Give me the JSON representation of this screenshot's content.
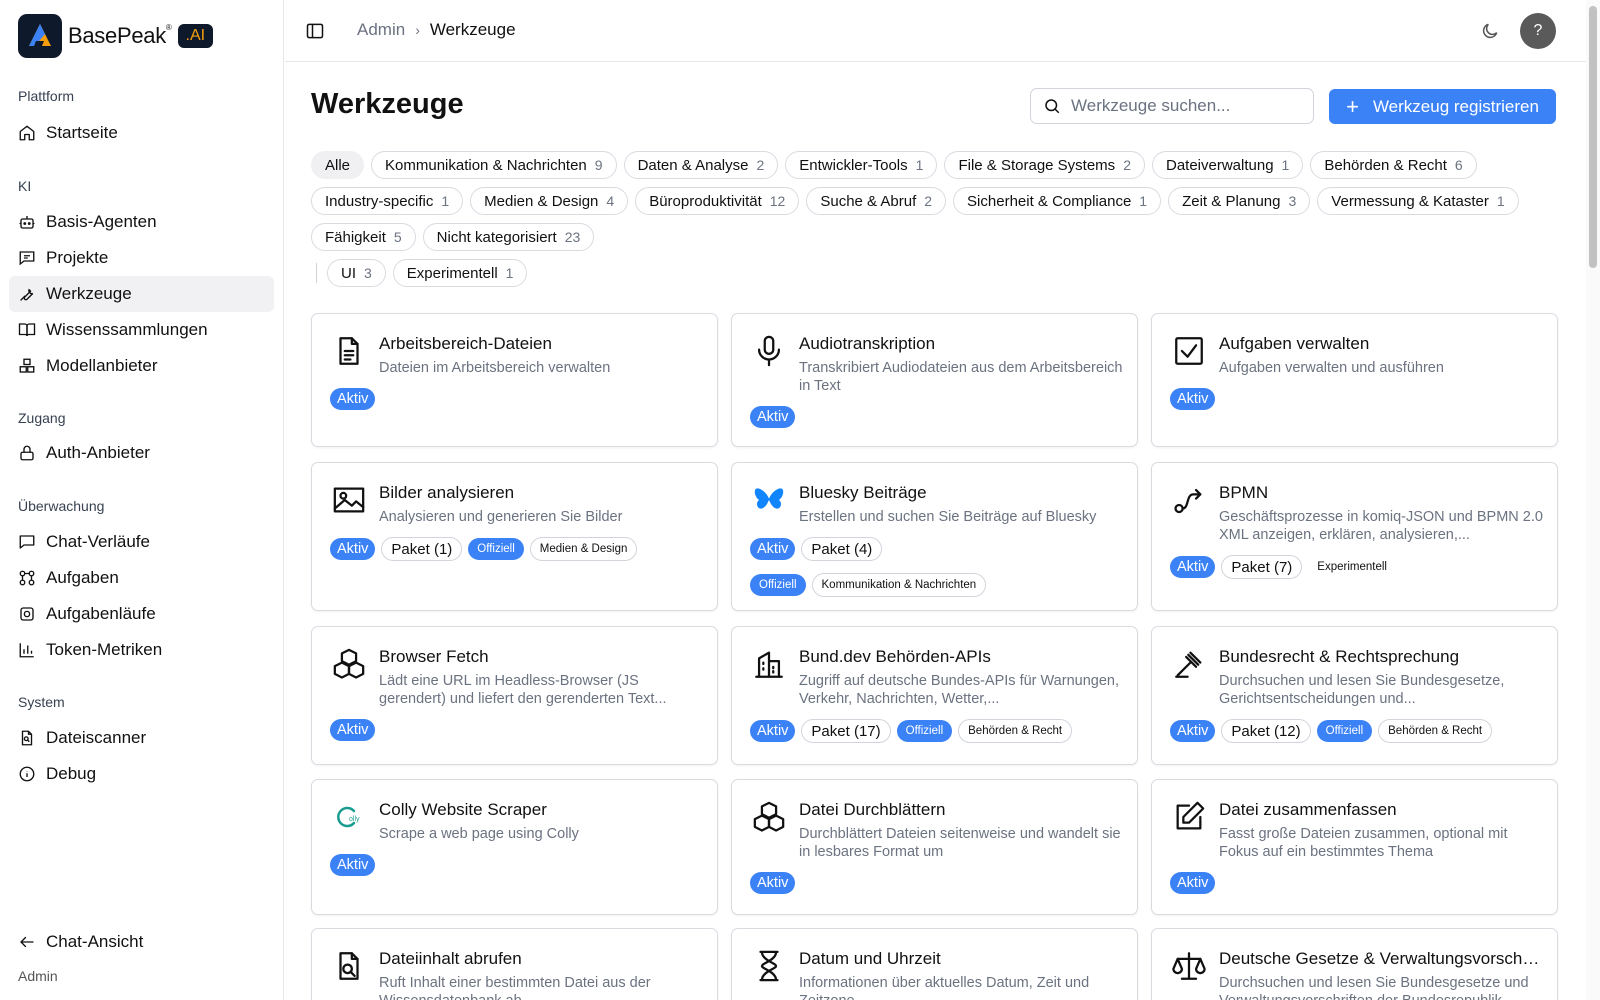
{
  "brand": {
    "name": "BasePeak",
    "reg": "®",
    "badge": ".AI"
  },
  "sidebar": {
    "groups": [
      {
        "label": "Plattform",
        "items": [
          {
            "label": "Startseite",
            "icon": "home-icon"
          }
        ]
      },
      {
        "label": "KI",
        "items": [
          {
            "label": "Basis-Agenten",
            "icon": "bot-icon"
          },
          {
            "label": "Projekte",
            "icon": "projects-icon"
          },
          {
            "label": "Werkzeuge",
            "icon": "wrench-icon",
            "active": true
          },
          {
            "label": "Wissenssammlungen",
            "icon": "book-icon"
          },
          {
            "label": "Modellanbieter",
            "icon": "boxes-icon"
          }
        ]
      },
      {
        "label": "Zugang",
        "items": [
          {
            "label": "Auth-Anbieter",
            "icon": "lock-icon"
          }
        ]
      },
      {
        "label": "Überwachung",
        "items": [
          {
            "label": "Chat-Verläufe",
            "icon": "chat-icon"
          },
          {
            "label": "Aufgaben",
            "icon": "workflow-icon"
          },
          {
            "label": "Aufgabenläufe",
            "icon": "cog-icon"
          },
          {
            "label": "Token-Metriken",
            "icon": "bar-chart-icon"
          }
        ]
      },
      {
        "label": "System",
        "items": [
          {
            "label": "Dateiscanner",
            "icon": "file-scan-icon"
          },
          {
            "label": "Debug",
            "icon": "info-icon"
          }
        ]
      }
    ],
    "back_label": "Chat-Ansicht",
    "footer_label": "Admin"
  },
  "topbar": {
    "breadcrumb": [
      "Admin",
      "Werkzeuge"
    ],
    "help_label": "?"
  },
  "main": {
    "title": "Werkzeuge",
    "search_placeholder": "Werkzeuge suchen...",
    "register_label": "Werkzeug registrieren"
  },
  "filters": {
    "rows": [
      [
        {
          "label": "Alle",
          "count": "",
          "active": true
        },
        {
          "label": "Kommunikation & Nachrichten",
          "count": "9"
        },
        {
          "label": "Daten & Analyse",
          "count": "2"
        },
        {
          "label": "Entwickler-Tools",
          "count": "1"
        },
        {
          "label": "File & Storage Systems",
          "count": "2"
        },
        {
          "label": "Dateiverwaltung",
          "count": "1"
        },
        {
          "label": "Behörden & Recht",
          "count": "6"
        }
      ],
      [
        {
          "label": "Industry-specific",
          "count": "1"
        },
        {
          "label": "Medien & Design",
          "count": "4"
        },
        {
          "label": "Büroproduktivität",
          "count": "12"
        },
        {
          "label": "Suche & Abruf",
          "count": "2"
        },
        {
          "label": "Sicherheit & Compliance",
          "count": "1"
        },
        {
          "label": "Zeit & Planung",
          "count": "3"
        },
        {
          "label": "Vermessung & Kataster",
          "count": "1"
        }
      ],
      [
        {
          "label": "Fähigkeit",
          "count": "5"
        },
        {
          "label": "Nicht kategorisiert",
          "count": "23"
        }
      ]
    ],
    "secondary": [
      {
        "label": "UI",
        "count": "3"
      },
      {
        "label": "Experimentell",
        "count": "1"
      }
    ]
  },
  "tools": [
    {
      "title": "Arbeitsbereich-Dateien",
      "desc": "Dateien im Arbeitsbereich verwalten",
      "icon": "file-text-icon",
      "badges": [
        {
          "t": "aktiv",
          "l": "Aktiv"
        }
      ]
    },
    {
      "title": "Audiotranskription",
      "desc": "Transkribiert Audiodateien aus dem Arbeitsbereich in Text",
      "icon": "microphone-icon",
      "badges": [
        {
          "t": "aktiv",
          "l": "Aktiv"
        }
      ]
    },
    {
      "title": "Aufgaben verwalten",
      "desc": "Aufgaben verwalten und ausführen",
      "icon": "checkbox-icon",
      "badges": [
        {
          "t": "aktiv",
          "l": "Aktiv"
        }
      ]
    },
    {
      "title": "Bilder analysieren",
      "desc": "Analysieren und generieren Sie Bilder",
      "icon": "image-icon",
      "badges": [
        {
          "t": "aktiv",
          "l": "Aktiv"
        },
        {
          "t": "paket",
          "l": "Paket (1)"
        },
        {
          "t": "off",
          "l": "Offiziell"
        },
        {
          "t": "cat",
          "l": "Medien & Design"
        }
      ]
    },
    {
      "title": "Bluesky Beiträge",
      "desc": "Erstellen und suchen Sie Beiträge auf Bluesky",
      "icon": "butterfly-icon",
      "badges": [
        {
          "t": "aktiv",
          "l": "Aktiv"
        },
        {
          "t": "paket",
          "l": "Paket (4)"
        },
        {
          "t": "break"
        },
        {
          "t": "off",
          "l": "Offiziell"
        },
        {
          "t": "cat",
          "l": "Kommunikation & Nachrichten"
        }
      ]
    },
    {
      "title": "BPMN",
      "desc": "Geschäftsprozesse in komiq-JSON und BPMN 2.0 XML anzeigen, erklären, analysieren,...",
      "icon": "route-icon",
      "badges": [
        {
          "t": "aktiv",
          "l": "Aktiv"
        },
        {
          "t": "paket",
          "l": "Paket (7)"
        },
        {
          "t": "plain",
          "l": "Experimentell"
        }
      ]
    },
    {
      "title": "Browser Fetch",
      "desc": "Lädt eine URL im Headless-Browser (JS gerendert) und liefert den gerenderten Text...",
      "icon": "boxes-icon",
      "badges": [
        {
          "t": "aktiv",
          "l": "Aktiv"
        }
      ]
    },
    {
      "title": "Bund.dev Behörden-APIs",
      "desc": "Zugriff auf deutsche Bundes-APIs für Warnungen, Verkehr, Nachrichten, Wetter,...",
      "icon": "building-icon",
      "badges": [
        {
          "t": "aktiv",
          "l": "Aktiv"
        },
        {
          "t": "paket",
          "l": "Paket (17)"
        },
        {
          "t": "off",
          "l": "Offiziell"
        },
        {
          "t": "cat",
          "l": "Behörden & Recht"
        }
      ]
    },
    {
      "title": "Bundesrecht & Rechtsprechung",
      "desc": "Durchsuchen und lesen Sie Bundesgesetze, Gerichtsentscheidungen und...",
      "icon": "gavel-icon",
      "badges": [
        {
          "t": "aktiv",
          "l": "Aktiv"
        },
        {
          "t": "paket",
          "l": "Paket (12)"
        },
        {
          "t": "off",
          "l": "Offiziell"
        },
        {
          "t": "cat",
          "l": "Behörden & Recht"
        }
      ]
    },
    {
      "title": "Colly Website Scraper",
      "desc": "Scrape a web page using Colly",
      "icon": "colly-logo-icon",
      "badges": [
        {
          "t": "aktiv",
          "l": "Aktiv"
        }
      ]
    },
    {
      "title": "Datei Durchblättern",
      "desc": "Durchblättert Dateien seitenweise und wandelt sie in lesbares Format um",
      "icon": "boxes-icon",
      "badges": [
        {
          "t": "aktiv",
          "l": "Aktiv"
        }
      ]
    },
    {
      "title": "Datei zusammenfassen",
      "desc": "Fasst große Dateien zusammen, optional mit Fokus auf ein bestimmtes Thema",
      "icon": "edit-icon",
      "badges": [
        {
          "t": "aktiv",
          "l": "Aktiv"
        }
      ]
    },
    {
      "title": "Dateiinhalt abrufen",
      "desc": "Ruft Inhalt einer bestimmten Datei aus der Wissensdatenbank ab",
      "icon": "file-search-icon",
      "badges": []
    },
    {
      "title": "Datum und Uhrzeit",
      "desc": "Informationen über aktuelles Datum, Zeit und Zeitzone",
      "icon": "hourglass-icon",
      "badges": []
    },
    {
      "title": "Deutsche Gesetze & Verwaltungsvorschriften",
      "desc": "Durchsuchen und lesen Sie Bundesgesetze und Verwaltungsvorschriften der Bundesrepublik",
      "icon": "scale-icon",
      "badges": []
    }
  ],
  "colors": {
    "accent": "#3b82f6",
    "brand_dark": "#0e1a2b",
    "brand_orange": "#f59e0b"
  }
}
